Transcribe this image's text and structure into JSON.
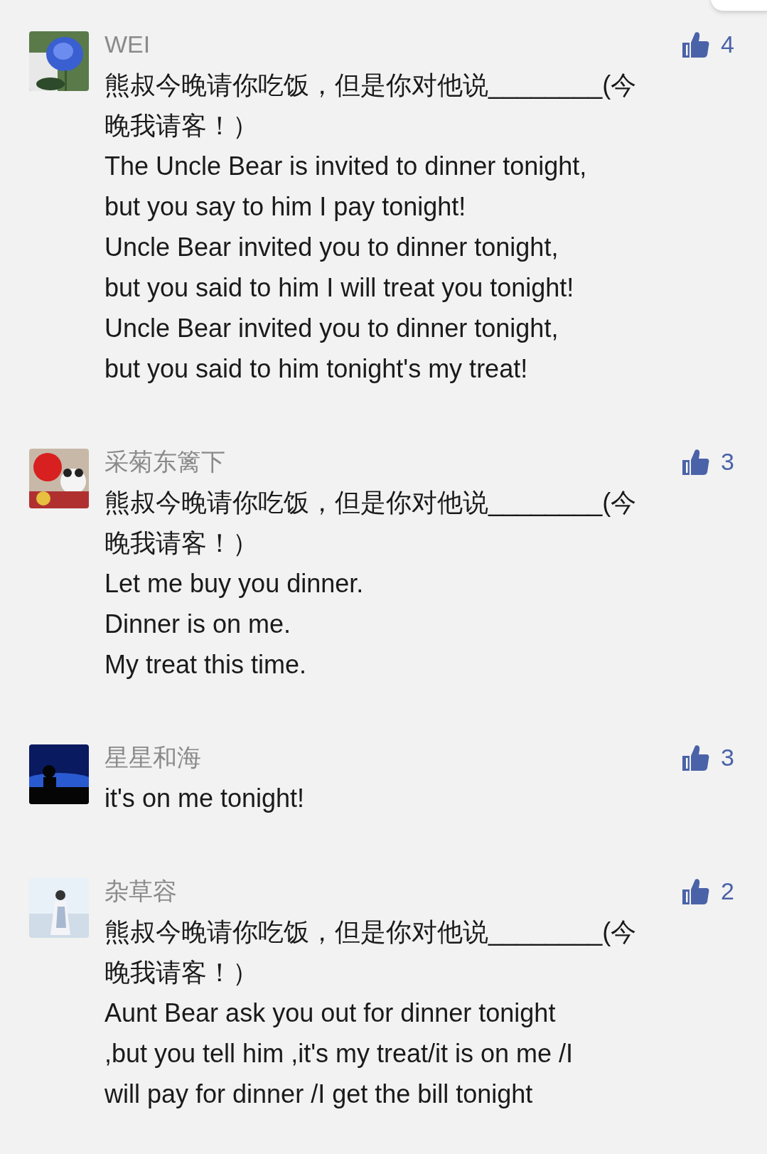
{
  "comments": [
    {
      "author": "WEI",
      "likes": "4",
      "lines": [
        "熊叔今晚请你吃饭，但是你对他说________(今",
        "晚我请客！）",
        "The Uncle Bear is invited to dinner tonight,",
        "but you say to him I pay tonight!",
        "Uncle Bear invited you to dinner tonight,",
        "but you said to him I will treat you tonight!",
        "Uncle Bear invited you to dinner tonight,",
        "but you said to him tonight's my treat!"
      ]
    },
    {
      "author": "采菊东篱下",
      "likes": "3",
      "lines": [
        "熊叔今晚请你吃饭，但是你对他说________(今",
        "晚我请客！）",
        "Let me buy you dinner.",
        "Dinner is on me.",
        "My treat this time."
      ]
    },
    {
      "author": "星星和海",
      "likes": "3",
      "lines": [
        "it's on me tonight!"
      ]
    },
    {
      "author": "杂草容",
      "likes": "2",
      "lines": [
        "熊叔今晚请你吃饭，但是你对他说________(今",
        "晚我请客！）",
        "Aunt Bear ask you out for dinner tonight",
        ",but you tell him ,it's my treat/it is on me /I",
        "will pay for dinner /I get the bill tonight"
      ]
    }
  ]
}
